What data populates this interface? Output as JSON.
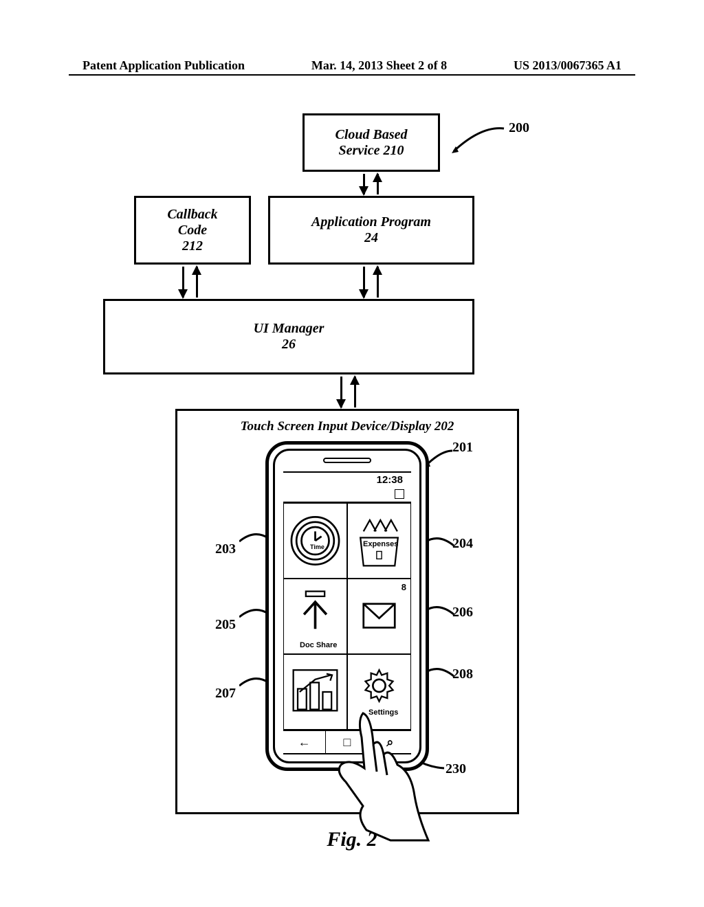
{
  "header": {
    "left": "Patent Application Publication",
    "center": "Mar. 14, 2013  Sheet 2 of 8",
    "right": "US 2013/0067365 A1"
  },
  "blocks": {
    "cloud": {
      "line1": "Cloud Based",
      "line2": "Service 210"
    },
    "callback": {
      "line1": "Callback",
      "line2": "Code",
      "line3": "212"
    },
    "app": {
      "line1": "Application Program",
      "line2": "24"
    },
    "ui": {
      "line1": "UI Manager",
      "line2": "26"
    },
    "touch_title": "Touch Screen Input Device/Display 202"
  },
  "phone": {
    "clock": "12:38",
    "tiles": {
      "time": "Time",
      "expenses": "Expenses",
      "docshare": "Doc Share",
      "mail_badge": "8",
      "settings": "Settings"
    },
    "nav": {
      "back": "←",
      "home": "□",
      "search": "⌕"
    }
  },
  "refs": {
    "r200": "200",
    "r201": "201",
    "r203": "203",
    "r204": "204",
    "r205": "205",
    "r206": "206",
    "r207": "207",
    "r208": "208",
    "r230": "230"
  },
  "figure_caption": "Fig. 2"
}
